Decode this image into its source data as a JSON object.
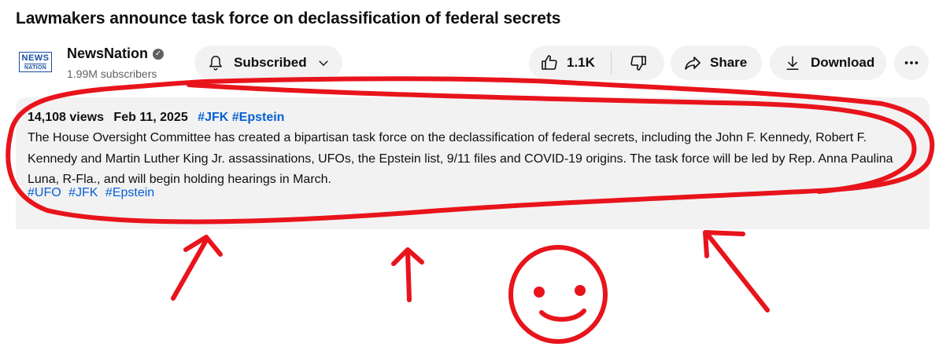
{
  "video": {
    "title": "Lawmakers announce task force on declassification of federal secrets"
  },
  "channel": {
    "logo_line1": "NEWS",
    "logo_line2": "NATION",
    "name": "NewsNation",
    "verified_icon": "checkmark-icon",
    "subscribers": "1.99M subscribers"
  },
  "actions": {
    "subscribed_label": "Subscribed",
    "like_count": "1.1K",
    "share_label": "Share",
    "download_label": "Download"
  },
  "description": {
    "views": "14,108 views",
    "date": "Feb 11, 2025",
    "header_tags": [
      "#JFK",
      "#Epstein"
    ],
    "text": "The House Oversight Committee has created a bipartisan task force on the declassification of federal secrets, including the John F. Kennedy, Robert F. Kennedy and Martin Luther King Jr. assassinations, UFOs, the Epstein list, 9/11 files and COVID-19 origins. The task force will be led by Rep. Anna Paulina Luna, R-Fla., and will begin holding hearings in March.",
    "tags": [
      "#UFO",
      "#JFK",
      "#Epstein"
    ]
  },
  "annotation": {
    "color": "#e8141c"
  }
}
